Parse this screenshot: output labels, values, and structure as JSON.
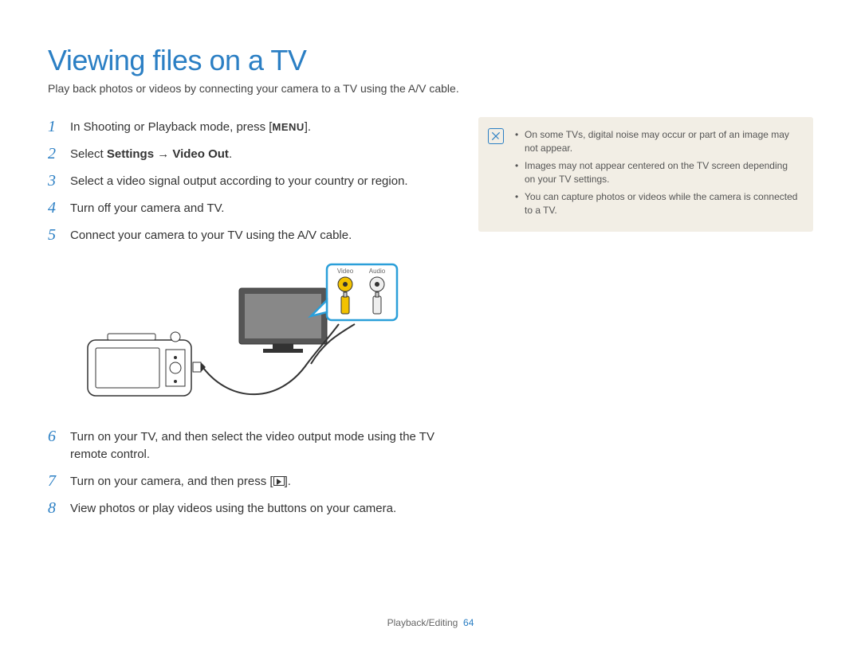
{
  "title": "Viewing files on a TV",
  "subtitle": "Play back photos or videos by connecting your camera to a TV using the A/V cable.",
  "steps": [
    {
      "n": "1",
      "pre": "In Shooting or Playback mode, press [",
      "btn": "MENU",
      "post": "]."
    },
    {
      "n": "2",
      "pre": "Select ",
      "bold": "Settings → Video Out",
      "post": "."
    },
    {
      "n": "3",
      "plain": "Select a video signal output according to your country or region."
    },
    {
      "n": "4",
      "plain": "Turn off your camera and TV."
    },
    {
      "n": "5",
      "plain": "Connect your camera to your TV using the A/V cable."
    },
    {
      "n": "6",
      "plain": "Turn on your TV, and then select the video output mode using the TV remote control."
    },
    {
      "n": "7",
      "pre": "Turn on your camera, and then press [",
      "icon": "play",
      "post": "]."
    },
    {
      "n": "8",
      "plain": "View photos or play videos using the buttons on your camera."
    }
  ],
  "diagram": {
    "video_label": "Video",
    "audio_label": "Audio"
  },
  "notes": [
    "On some TVs, digital noise may occur or part of an image may not appear.",
    "Images may not appear centered on the TV screen depending on your TV settings.",
    "You can capture photos or videos while the camera is connected to a TV."
  ],
  "footer": {
    "section": "Playback/Editing",
    "page": "64"
  }
}
